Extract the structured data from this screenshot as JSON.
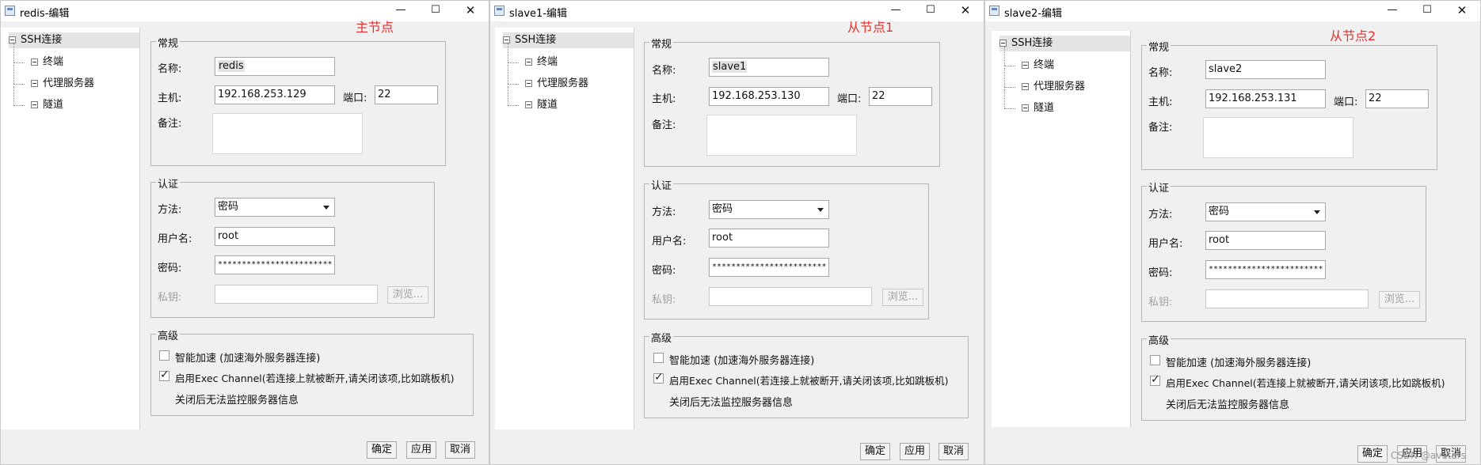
{
  "labels": {
    "ssh_root": "SSH连接",
    "tree_terminal": "终端",
    "tree_proxy": "代理服务器",
    "tree_tunnel": "隧道",
    "group_general": "常规",
    "name": "名称:",
    "host": "主机:",
    "port": "端口:",
    "notes": "备注:",
    "group_auth": "认证",
    "method": "方法:",
    "username": "用户名:",
    "password": "密码:",
    "private_key": "私钥:",
    "browse": "浏览...",
    "group_advanced": "高级",
    "smart_accel": "智能加速 (加速海外服务器连接)",
    "exec_channel": "启用Exec Channel(若连接上就被断开,请关闭该项,比如跳板机)",
    "exec_note": "关闭后无法监控服务器信息",
    "ok": "确定",
    "apply": "应用",
    "cancel": "取消",
    "minimize": "—",
    "maximize": "☐",
    "close": "✕"
  },
  "windows": [
    {
      "title": "redis-编辑",
      "annotation": "主节点",
      "name_value": "redis",
      "host_value": "192.168.253.129",
      "port_value": "22",
      "method_value": "密码",
      "username_value": "root",
      "password_value": "************************",
      "smart_accel_checked": false,
      "exec_channel_checked": true
    },
    {
      "title": "slave1-编辑",
      "annotation": "从节点1",
      "name_value": "slave1",
      "host_value": "192.168.253.130",
      "port_value": "22",
      "method_value": "密码",
      "username_value": "root",
      "password_value": "************************",
      "smart_accel_checked": false,
      "exec_channel_checked": true
    },
    {
      "title": "slave2-编辑",
      "annotation": "从节点2",
      "name_value": "slave2",
      "host_value": "192.168.253.131",
      "port_value": "22",
      "method_value": "密码",
      "username_value": "root",
      "password_value": "************************",
      "smart_accel_checked": false,
      "exec_channel_checked": true
    }
  ],
  "watermark": "CSDN @avatars"
}
